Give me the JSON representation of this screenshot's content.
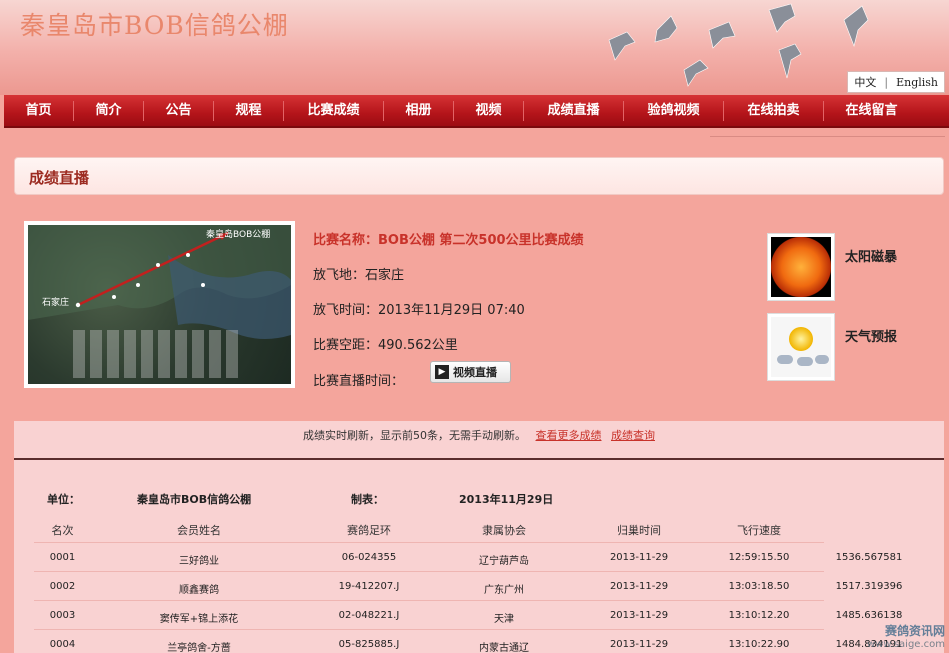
{
  "site": {
    "title": "秦皇岛市BOB信鸽公棚"
  },
  "language": {
    "chinese": "中文",
    "english": "English"
  },
  "nav": [
    "首页",
    "简介",
    "公告",
    "规程",
    "比赛成绩",
    "相册",
    "视频",
    "成绩直播",
    "验鸽视频",
    "在线拍卖",
    "在线留言"
  ],
  "section": {
    "title": "成绩直播"
  },
  "race": {
    "name": "比赛名称：BOB公棚 第二次500公里比赛成绩",
    "release_place": "放飞地：石家庄",
    "release_time": "放飞时间：2013年11月29日 07:40",
    "distance": "比赛空距：490.562公里",
    "live_time": "比赛直播时间：",
    "live_button": "视频直播",
    "map_top_label": "秦皇岛BOB公棚",
    "map_left_label": "石家庄"
  },
  "side": {
    "solar": "太阳磁暴",
    "weather": "天气预报"
  },
  "results": {
    "note": "成绩实时刷新，显示前50条，无需手动刷新。",
    "link_more": "查看更多成绩",
    "link_query": "成绩查询",
    "unit_label": "单位：",
    "unit_value": "秦皇岛市BOB信鸽公棚",
    "made_label": "制表：",
    "made_value": "2013年11月29日",
    "columns": [
      "名次",
      "会员姓名",
      "赛鸽足环",
      "隶属协会",
      "归巢时间",
      "飞行速度"
    ],
    "rows": [
      [
        "0001",
        "三好鸽业",
        "06-024355",
        "辽宁葫芦岛",
        "2013-11-29",
        "12:59:15.50",
        "1536.567581"
      ],
      [
        "0002",
        "顺鑫赛鸽",
        "19-412207.J",
        "广东广州",
        "2013-11-29",
        "13:03:18.50",
        "1517.319396"
      ],
      [
        "0003",
        "窦传军+锦上添花",
        "02-048221.J",
        "天津",
        "2013-11-29",
        "13:10:12.20",
        "1485.636138"
      ],
      [
        "0004",
        "兰亭鸽舍-方蔷",
        "05-825885.J",
        "内蒙古通辽",
        "2013-11-29",
        "13:10:22.90",
        "1484.834191"
      ]
    ]
  },
  "watermark": {
    "line1": "赛鸽资讯网",
    "line2": "www.saige.com"
  }
}
